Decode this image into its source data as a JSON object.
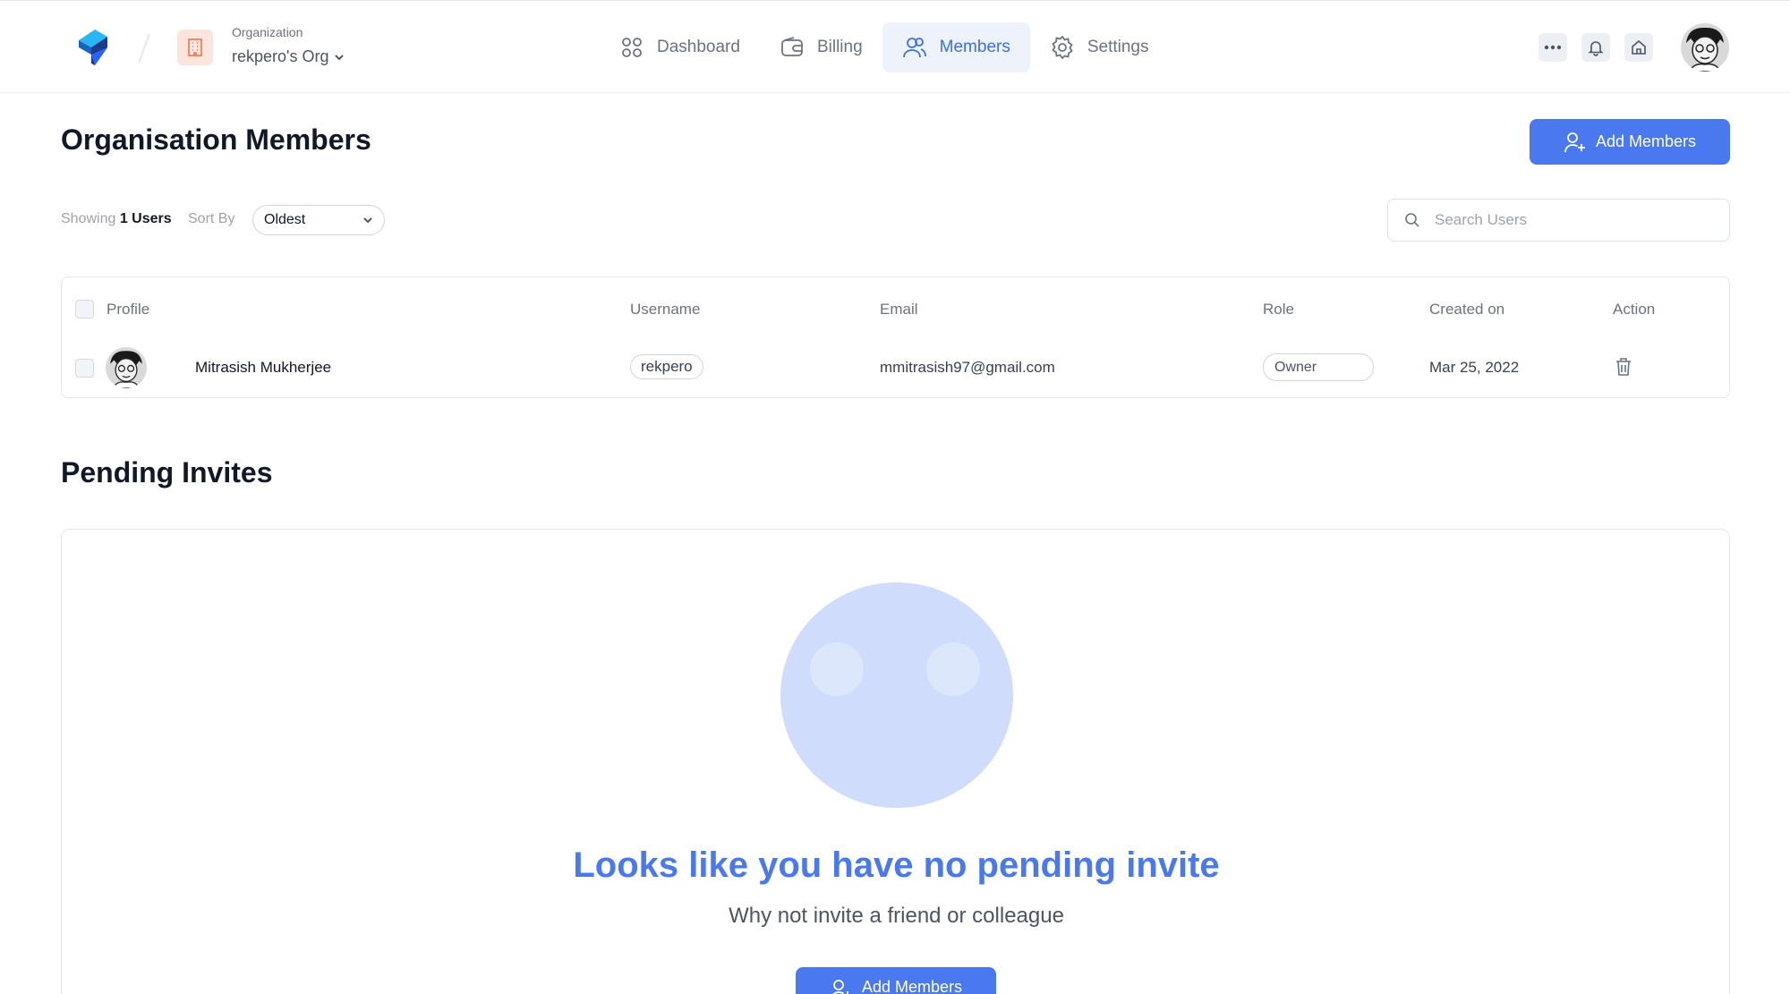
{
  "header": {
    "org_label": "Organization",
    "org_name": "rekpero's Org",
    "nav": [
      {
        "label": "Dashboard",
        "icon": "grid-icon"
      },
      {
        "label": "Billing",
        "icon": "wallet-icon"
      },
      {
        "label": "Members",
        "icon": "users-icon",
        "active": true
      },
      {
        "label": "Settings",
        "icon": "gear-icon"
      }
    ],
    "accent_color": "#4a78ef"
  },
  "members": {
    "title": "Organisation Members",
    "add_button": "Add Members",
    "showing_prefix": "Showing",
    "showing_count": "1 Users",
    "sort_label": "Sort By",
    "sort_value": "Oldest",
    "search_placeholder": "Search Users",
    "columns": [
      "Profile",
      "Username",
      "Email",
      "Role",
      "Created on",
      "Action"
    ],
    "rows": [
      {
        "name": "Mitrasish Mukherjee",
        "username": "rekpero",
        "email": "mmitrasish97@gmail.com",
        "role": "Owner",
        "created_on": "Mar 25, 2022"
      }
    ]
  },
  "pending": {
    "title": "Pending Invites",
    "empty_title": "Looks like you have no pending invite",
    "empty_subtitle": "Why not invite a friend or colleague",
    "add_button": "Add Members"
  }
}
